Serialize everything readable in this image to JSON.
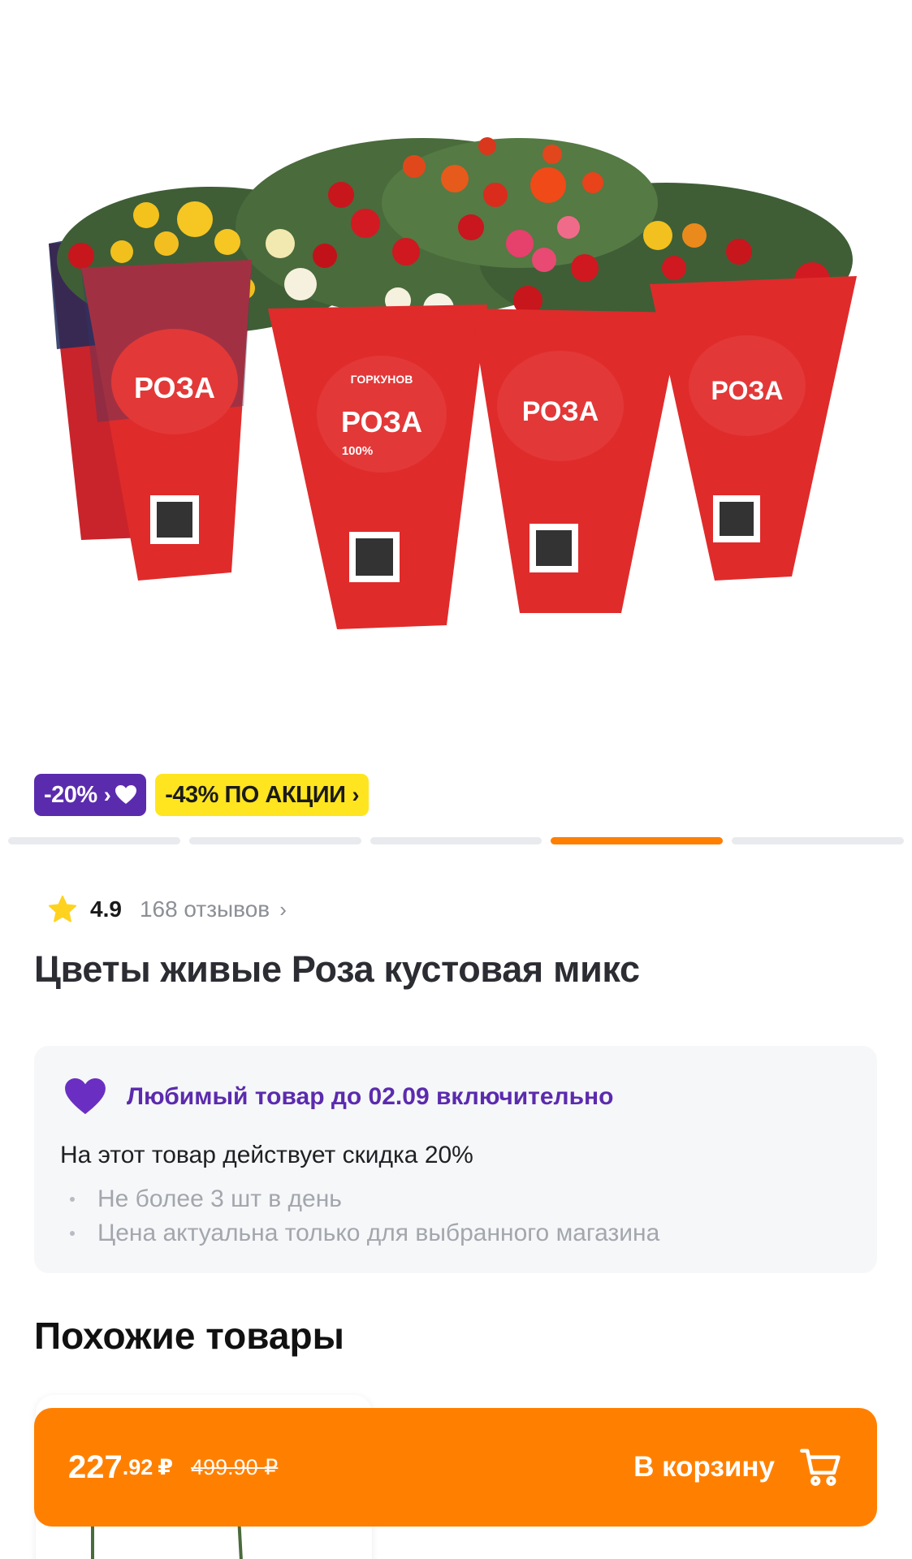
{
  "badges": {
    "discount": "-20%",
    "promo": "-43% ПО АКЦИИ"
  },
  "gallery": {
    "count": 5,
    "active_index": 3
  },
  "product": {
    "rating": "4.9",
    "reviews": "168 отзывов",
    "title": "Цветы живые Роза кустовая микс",
    "pot_brand": "ГОРКУНОВ",
    "pot_label": "РОЗА",
    "pot_percent": "100%"
  },
  "promo_card": {
    "header": "Любимый товар до 02.09 включительно",
    "description": "На этот товар действует скидка 20%",
    "conditions": [
      "Не более 3 шт в день",
      "Цена актуальна только для выбранного магазина"
    ]
  },
  "similar": {
    "title": "Похожие товары"
  },
  "buy_bar": {
    "price_integer": "227",
    "price_fraction": ".92",
    "currency": "₽",
    "old_price": "499.90 ₽",
    "cart_label": "В корзину"
  },
  "colors": {
    "accent": "#ff8000",
    "purple": "#5b2bae",
    "yellow": "#ffe51f",
    "star": "#ffd21f"
  }
}
